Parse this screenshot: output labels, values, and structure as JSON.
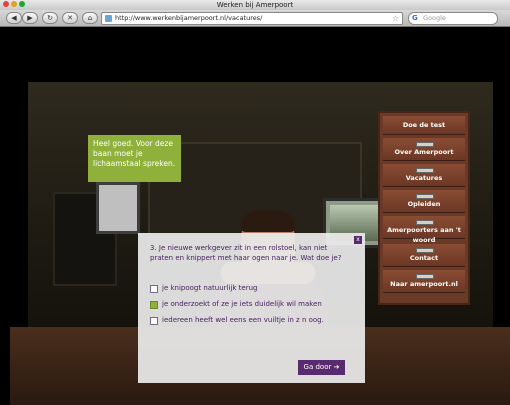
{
  "window": {
    "title": "Werken bij Amerpoort"
  },
  "browser": {
    "back": "◀",
    "forward": "▶",
    "reload": "↻",
    "stop": "✕",
    "home": "⌂",
    "url": "http://www.werkenbijamerpoort.nl/vacatures/",
    "search_placeholder": "Google"
  },
  "bubble": {
    "text": "Heel goed. Voor deze baan moet je lichaamstaal spreken."
  },
  "menu": {
    "items": [
      {
        "label": "Doe de test"
      },
      {
        "label": "Over Amerpoort"
      },
      {
        "label": "Vacatures"
      },
      {
        "label": "Opleiden"
      },
      {
        "label": "Amerpoorters aan 't woord"
      },
      {
        "label": "Contact"
      },
      {
        "label": "Naar amerpoort.nl"
      }
    ]
  },
  "question": {
    "text": "3. Je nieuwe werkgever zit in een rolstoel, kan niet praten en knippert met haar ogen naar je. Wat doe je?",
    "close": "x",
    "options": [
      {
        "label": "je knipoogt natuurlijk terug",
        "checked": false
      },
      {
        "label": "je onderzoekt of ze je iets duidelijk wil maken",
        "checked": true
      },
      {
        "label": "iedereen heeft wel eens een vuiltje in z n oog.",
        "checked": false
      }
    ],
    "next_label": "Ga door ➔"
  },
  "colors": {
    "accent_purple": "#5a2a70",
    "bubble_green": "#8fb03a",
    "drawer_brown": "#6b3725"
  }
}
